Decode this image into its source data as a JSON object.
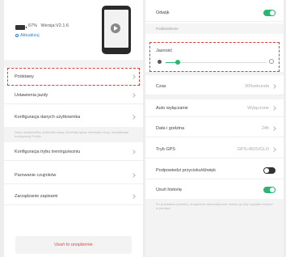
{
  "device": {
    "battery": "67%",
    "version": "Wersja:V2.1.6",
    "update_link": "Aktualizuj"
  },
  "left_menu": {
    "items": [
      {
        "label": "Podstawy"
      },
      {
        "label": "Ustawienia jazdy"
      },
      {
        "label": "Konfiguracja danych użytkownika"
      }
    ],
    "description": "Dane użytkownika, jednostki miary, interwały tętna, interwały mocy, modyfikacja konfiguracji Profilu",
    "items2": [
      {
        "label": "Konfiguracja trybu treningu/wzniu"
      },
      {
        "label": "Parowanie czujników"
      },
      {
        "label": "Zarządzanie zapisami"
      }
    ],
    "unbind_button": "Usuń to urządzenie"
  },
  "right_panel": {
    "odwijk_label": "Odwijk",
    "odwijk_on": true,
    "section_header": "Podświetlenie",
    "brightness_label": "Jasność",
    "brightness_level": 0.12,
    "rows": [
      {
        "label": "Czas",
        "value": "300sekunda"
      },
      {
        "label": "Auto wyłączanie",
        "value": "Wyłączone"
      },
      {
        "label": "Data i godzina",
        "value": "24h"
      },
      {
        "label": "Tryb GPS",
        "value": "GPS+BDS/GLO"
      }
    ],
    "vibrate_label": "Podpowiedzi przycisku/dźwięk",
    "vibrate_on": false,
    "delete_history_label": "Usuń historię",
    "delete_history_on": true,
    "delete_history_desc": "Po przesłaniu pomiaru, urządzenie automatycznie usunie go aby uzyskać miejsce w pamięci"
  },
  "colors": {
    "accent": "#2bb673",
    "highlight": "#e23a3a",
    "link": "#2f7fd1"
  }
}
